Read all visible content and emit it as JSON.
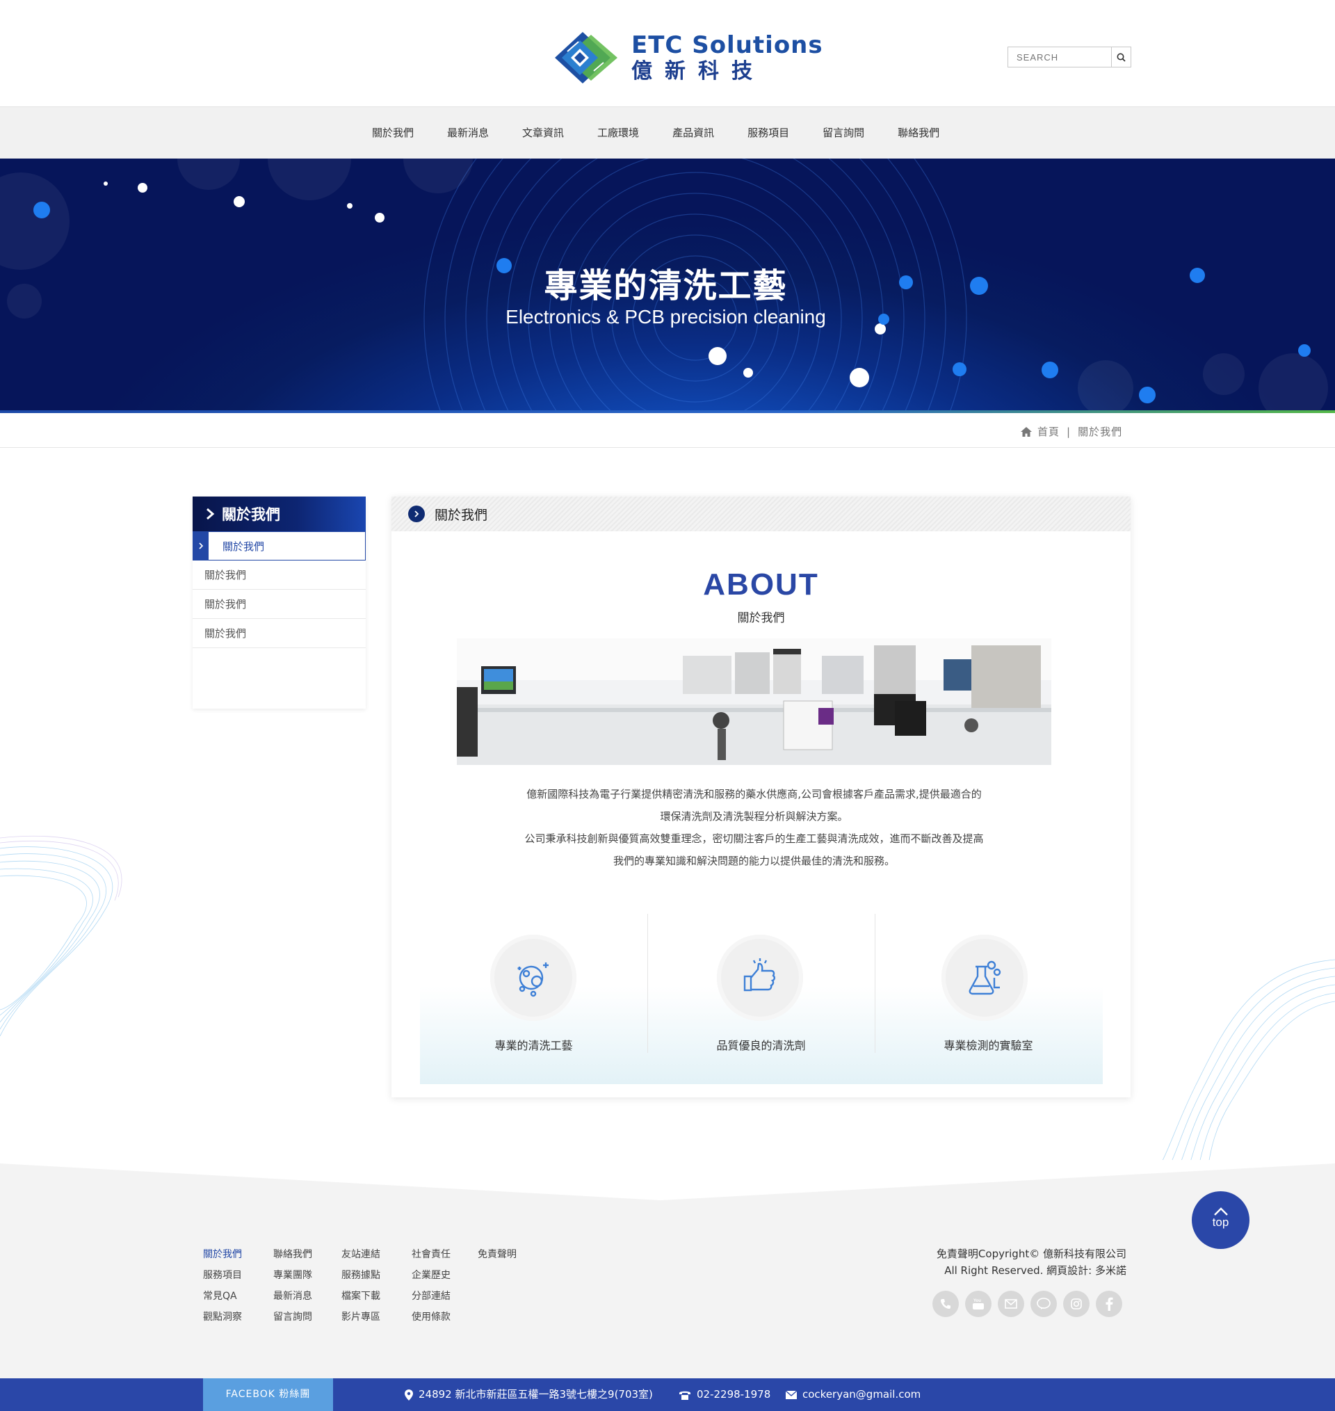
{
  "header": {
    "logo_en": "ETC Solutions",
    "logo_cn": "億新科技",
    "search_placeholder": "SEARCH"
  },
  "nav": {
    "items": [
      "關於我們",
      "最新消息",
      "文章資訊",
      "工廠環境",
      "產品資訊",
      "服務項目",
      "留言詢問",
      "聯絡我們"
    ]
  },
  "banner": {
    "title": "專業的清洗工藝",
    "subtitle": "Electronics & PCB precision cleaning"
  },
  "breadcrumb": {
    "home": "首頁",
    "separator": "|",
    "current": "關於我們"
  },
  "sidebar": {
    "title": "關於我們",
    "active": "關於我們",
    "items": [
      "關於我們",
      "關於我們",
      "關於我們"
    ]
  },
  "main": {
    "header": "關於我們",
    "about_en": "ABOUT",
    "about_cn": "關於我們",
    "desc_lines": [
      "億新國際科技為電子行業提供精密清洗和服務的藥水供應商,公司會根據客戶產品需求,提供最適合的",
      "環保清洗劑及清洗製程分析與解決方案。",
      "公司秉承科技創新與優質高效雙重理念，密切關注客戶的生產工藝與清洗成效，進而不斷改善及提高",
      "我們的專業知識和解決問題的能力以提供最佳的清洗和服務。"
    ],
    "features": [
      {
        "label": "專業的清洗工藝",
        "icon": "cleaning-bubbles-icon"
      },
      {
        "label": "品質優良的清洗劑",
        "icon": "thumbs-up-icon"
      },
      {
        "label": "專業檢測的實驗室",
        "icon": "lab-flask-icon"
      }
    ]
  },
  "footer": {
    "columns": [
      [
        "關於我們",
        "服務項目",
        "常見QA",
        "觀點洞察"
      ],
      [
        "聯絡我們",
        "專業團隊",
        "最新消息",
        "留言詢問"
      ],
      [
        "友站連結",
        "服務據點",
        "檔案下載",
        "影片專區"
      ],
      [
        "社會責任",
        "企業歷史",
        "分部連結",
        "使用條款"
      ],
      [
        "免責聲明"
      ]
    ],
    "copyright_line1": "免責聲明Copyright© 億新科技有限公司",
    "copyright_line2": "All Right Reserved. 網頁設計: 多米諾",
    "social_icons": [
      "phone-icon",
      "youtube-icon",
      "mail-icon",
      "line-icon",
      "instagram-icon",
      "facebook-icon"
    ],
    "top_label": "top"
  },
  "bottom_bar": {
    "facebook": "FACEBOK 粉絲團",
    "address": "24892  新北市新莊區五權一路3號七樓之9(703室)",
    "phone": "02-2298-1978",
    "email": "cockeryan@gmail.com"
  },
  "colors": {
    "brand_blue": "#2a47a8",
    "nav_bg": "#f1f1f1",
    "banner_dark": "#06155a",
    "facebook_btn": "#5a9fe0"
  }
}
